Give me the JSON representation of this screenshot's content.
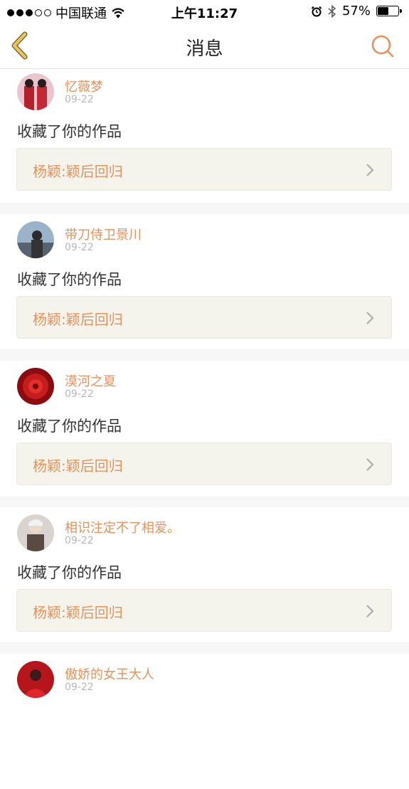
{
  "status_bar": {
    "carrier": "中国联通",
    "time": "上午11:27",
    "battery_percent": "57%",
    "battery_level": 0.57,
    "signal_bars_filled": 3,
    "signal_bars_total": 5,
    "icons": [
      "wifi-icon",
      "alarm-icon",
      "bluetooth-icon",
      "battery-icon"
    ]
  },
  "nav": {
    "title": "消息",
    "back_icon": "chevron-left-icon",
    "search_icon": "search-icon",
    "accent_color": "#e8915b",
    "back_color": "#d4b35a"
  },
  "messages": [
    {
      "user": "忆薇梦",
      "date": "09-22",
      "action": "收藏了你的作品",
      "work": "杨颖:颖后回归"
    },
    {
      "user": "带刀侍卫景川",
      "date": "09-22",
      "action": "收藏了你的作品",
      "work": "杨颖:颖后回归"
    },
    {
      "user": "漠河之夏",
      "date": "09-22",
      "action": "收藏了你的作品",
      "work": "杨颖:颖后回归"
    },
    {
      "user": "相识注定不了相爱。",
      "date": "09-22",
      "action": "收藏了你的作品",
      "work": "杨颖:颖后回归"
    },
    {
      "user": "傲娇的女王大人",
      "date": "09-22"
    }
  ]
}
